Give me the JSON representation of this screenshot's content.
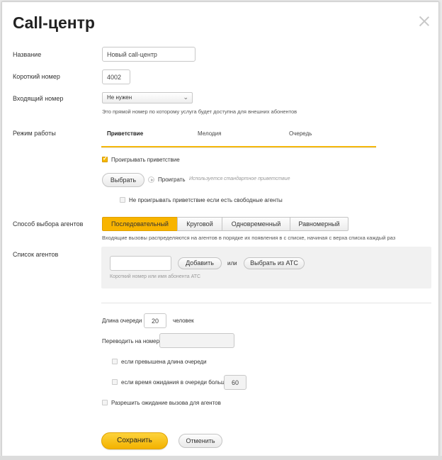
{
  "dialog": {
    "title": "Call-центр"
  },
  "form": {
    "name_label": "Название",
    "name_value": "Новый call-центр",
    "short_label": "Короткий номер",
    "short_value": "4002",
    "incoming_label": "Входящий номер",
    "incoming_value": "Не нужен",
    "incoming_hint": "Это прямой номер по которому услуга будет доступна для внешних абонентов",
    "mode_label": "Режим работы",
    "tabs": [
      {
        "label": "Приветствие",
        "active": true
      },
      {
        "label": "Мелодия",
        "active": false
      },
      {
        "label": "Очередь",
        "active": false
      }
    ],
    "greeting": {
      "play_checkbox_label": "Проигрывать приветствие",
      "play_checked": true,
      "choose_button": "Выбрать",
      "play_link": "Проиграть",
      "standard_hint": "Используется стандартное приветствие",
      "no_play_checkbox_label": "Не проигрывать приветствие если есть свободные агенты",
      "no_play_checked": false
    },
    "agent_method_label": "Способ выбора агентов",
    "methods": [
      {
        "label": "Последовательный",
        "active": true
      },
      {
        "label": "Круговой",
        "active": false
      },
      {
        "label": "Одновременный",
        "active": false
      },
      {
        "label": "Равномерный",
        "active": false
      }
    ],
    "method_hint": "Входящие вызовы распределяются на агентов в порядке их появления в с списке, начиная с верха списка каждый раз",
    "agents_label": "Список агентов",
    "agents": {
      "add_button": "Добавить",
      "or_text": "или",
      "pick_button": "Выбрать из АТС",
      "input_hint": "Короткий номер или имя абонента АТС"
    },
    "queue": {
      "length_label": "Длина очереди",
      "length_value": "20",
      "length_unit": "человек",
      "forward_label": "Переводить на номер",
      "forward_value": "",
      "exceeded_label": "если превышена длина очереди",
      "wait_label": "если время ожидания в очереди больше",
      "wait_value": "60",
      "allow_label": "Разрешить ожидание вызова для агентов"
    }
  },
  "footer": {
    "save_button": "Сохранить",
    "cancel_button": "Отменить"
  },
  "colors": {
    "accent": "#f5b80c",
    "active_segment": "#f8b400"
  }
}
